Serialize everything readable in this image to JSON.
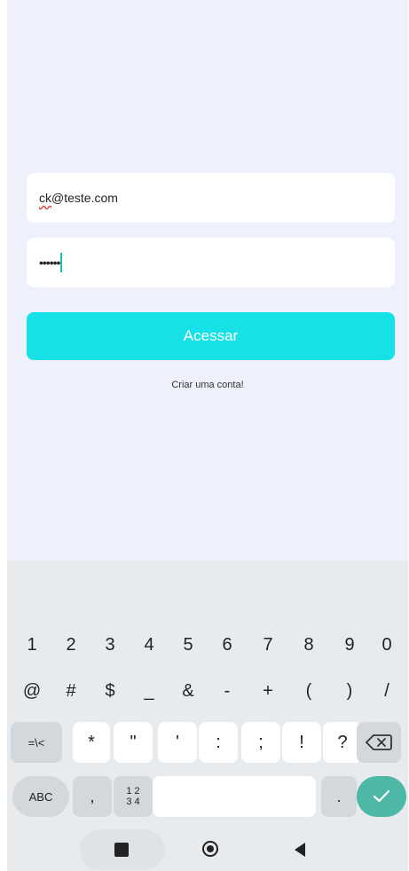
{
  "form": {
    "email_prefix": "ck",
    "email_suffix": "@teste.com",
    "password_masked": "••••••",
    "login_label": "Acessar",
    "create_account_label": "Criar uma conta!"
  },
  "keyboard": {
    "row1": [
      "1",
      "2",
      "3",
      "4",
      "5",
      "6",
      "7",
      "8",
      "9",
      "0"
    ],
    "row2": [
      "@",
      "#",
      "$",
      "_",
      "&",
      "-",
      "+",
      "(",
      ")",
      "/"
    ],
    "row3": [
      "=\\<",
      "*",
      "\"",
      "'",
      ":",
      ";",
      "!",
      "?"
    ],
    "abc_label": "ABC",
    "comma_label": ",",
    "num_top": "1 2",
    "num_bottom": "3 4",
    "period_label": "."
  },
  "colors": {
    "accent": "#16e1e7",
    "enter_key": "#4db8a6",
    "background": "#eef1fb"
  }
}
